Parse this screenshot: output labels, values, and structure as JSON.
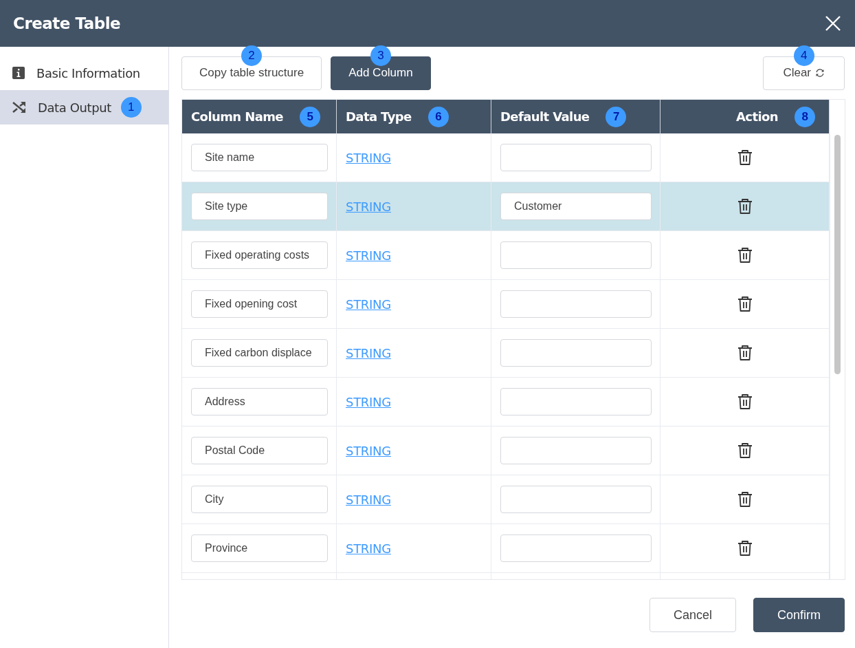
{
  "window": {
    "title": "Create Table"
  },
  "sidebar": {
    "items": [
      {
        "label": "Basic Information",
        "kind": "info",
        "selected": false
      },
      {
        "label": "Data Output",
        "kind": "shuffle",
        "selected": true,
        "callout": "1"
      }
    ]
  },
  "toolbar": {
    "buttons": [
      {
        "label": "Copy table structure",
        "kind": "outline",
        "callout": "2"
      },
      {
        "label": "Add Column",
        "kind": "primary",
        "callout": "3"
      }
    ],
    "clear": {
      "label": "Clear",
      "callout": "4"
    }
  },
  "table": {
    "columns": [
      {
        "label": "Column Name",
        "callout": "5"
      },
      {
        "label": "Data Type",
        "callout": "6"
      },
      {
        "label": "Default Value",
        "callout": "7"
      },
      {
        "label": "Action",
        "callout": "8"
      }
    ],
    "rows": [
      {
        "name": "Site name",
        "type": "STRING",
        "default": "",
        "selected": false
      },
      {
        "name": "Site type",
        "type": "STRING",
        "default": "Customer",
        "selected": true
      },
      {
        "name": "Fixed operating costs",
        "type": "STRING",
        "default": "",
        "selected": false
      },
      {
        "name": "Fixed opening cost",
        "type": "STRING",
        "default": "",
        "selected": false
      },
      {
        "name": "Fixed carbon displace",
        "type": "STRING",
        "default": "",
        "selected": false
      },
      {
        "name": "Address",
        "type": "STRING",
        "default": "",
        "selected": false
      },
      {
        "name": "Postal Code",
        "type": "STRING",
        "default": "",
        "selected": false
      },
      {
        "name": "City",
        "type": "STRING",
        "default": "",
        "selected": false
      },
      {
        "name": "Province",
        "type": "STRING",
        "default": "",
        "selected": false
      }
    ]
  },
  "footer": {
    "buttons": [
      {
        "label": "Cancel",
        "kind": "outline"
      },
      {
        "label": "Confirm",
        "kind": "primary"
      }
    ]
  }
}
